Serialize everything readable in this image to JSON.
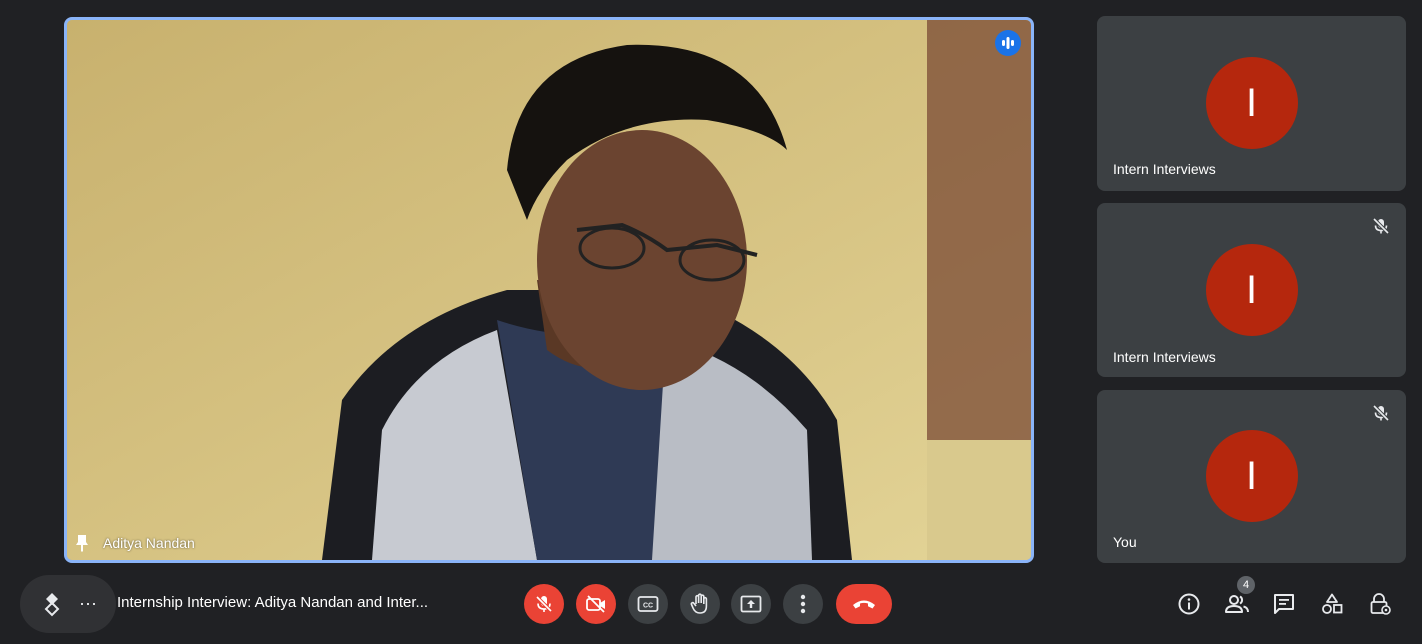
{
  "main_video": {
    "participant_name": "Aditya Nandan"
  },
  "side_tiles": [
    {
      "initial": "I",
      "name": "Intern Interviews",
      "muted": false
    },
    {
      "initial": "I",
      "name": "Intern Interviews",
      "muted": true
    },
    {
      "initial": "I",
      "name": "You",
      "muted": true
    }
  ],
  "meeting": {
    "title": "Internship Interview: Aditya Nandan and Inter..."
  },
  "more_label": "⋯",
  "participants_count": "4",
  "colors": {
    "background": "#202124",
    "tile": "#3c4043",
    "avatar": "#b5270d",
    "danger": "#ea4335",
    "active_border": "#8ab4f8"
  },
  "icons": {
    "companion": "companion-icon",
    "mic_off": "mic-off-icon",
    "camera_off": "camera-off-icon",
    "captions": "captions-icon",
    "raise_hand": "raise-hand-icon",
    "present": "present-screen-icon",
    "more": "more-vert-icon",
    "end_call": "end-call-icon",
    "info": "info-icon",
    "people": "people-icon",
    "chat": "chat-icon",
    "activities": "activities-icon",
    "host_controls": "host-controls-icon"
  }
}
